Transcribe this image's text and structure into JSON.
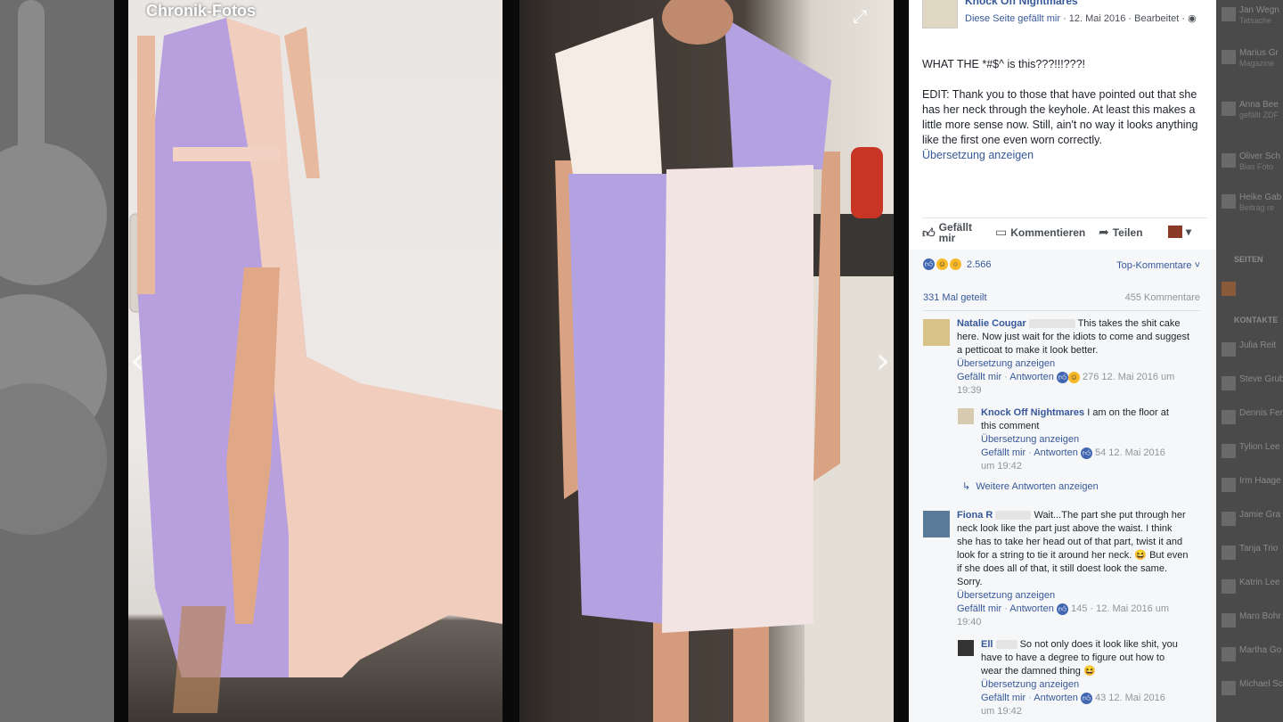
{
  "photo_viewer": {
    "label": "Chronik-Fotos",
    "prev_arrow": "‹",
    "next_arrow": "›",
    "expand_icon": "⤢"
  },
  "post": {
    "page_name": "Knock Off Nightmares",
    "meta_like": "Diese Seite gefällt mir",
    "meta_date": "· 12. Mai 2016 · Bearbeitet ·",
    "text_line1": "WHAT THE *#$^ is this???!!!???!",
    "text_edit": "EDIT: Thank you to those that have pointed out that she has her neck through the keyhole. At least this makes a little more sense now. Still, ain't no way it looks anything like the first one even worn correctly.",
    "translate": "Übersetzung anzeigen"
  },
  "actions": {
    "like": "Gefällt mir",
    "comment": "Kommentieren",
    "share": "Teilen"
  },
  "feedback": {
    "reactions_count": "2.566",
    "top_comments": "Top-Kommentare ˅",
    "shares": "331 Mal geteilt",
    "comments": "455 Kommentare"
  },
  "comments": [
    {
      "name": "Natalie Cougar",
      "text": "This takes the shit cake here. Now just wait for the idiots to come and suggest a petticoat to make it look better.",
      "translate": "Übersetzung anzeigen",
      "like": "Gefällt mir",
      "reply": "Antworten",
      "reactions": "276",
      "date": "12. Mai 2016 um 19:39"
    },
    {
      "name": "Knock Off Nightmares",
      "text": "I am on the floor at this comment",
      "translate": "Übersetzung anzeigen",
      "like": "Gefällt mir",
      "reply": "Antworten",
      "reactions": "54",
      "date": "12. Mai 2016 um 19:42"
    },
    {
      "more": "Weitere Antworten anzeigen"
    },
    {
      "name": "Fiona R",
      "text": "Wait...The part she put through her neck look like the part just above the waist. I think she has to take her head out of that part, twist it and look for a string to tie it around her neck. 😆 But even if she does all of that, it still doest look the same. Sorry.",
      "translate": "Übersetzung anzeigen",
      "like": "Gefällt mir",
      "reply": "Antworten",
      "reactions": "145",
      "date": "12. Mai 2016 um 19:40"
    },
    {
      "name": "Ell",
      "text": "So not only does it look like shit, you have to have a degree to figure out how to wear the damned thing 😆",
      "translate": "Übersetzung anzeigen",
      "like": "Gefällt mir",
      "reply": "Antworten",
      "reactions": "43",
      "date": "12. Mai 2016 um 19:42"
    }
  ],
  "right_sidebar": {
    "items": [
      {
        "name": "Jan Wegn",
        "sub": "Tatsache"
      },
      {
        "name": "Marius Gr",
        "sub": "Magazine"
      },
      {
        "name": "Anna Bee",
        "sub": "gefällt ZDF"
      },
      {
        "name": "Oliver Sch",
        "sub": "Bias Foto"
      },
      {
        "name": "Heike Gab",
        "sub": "Beitrag re"
      }
    ],
    "section1": "SEITEN",
    "section2": "KONTAKTE",
    "contacts": [
      "Julia Reit",
      "Steve Grub",
      "Dennis Fer",
      "Tylion Lee",
      "Irm Haage",
      "Jamie Gra",
      "Tanja Trio",
      "Katrin Lee",
      "Maro Bohr",
      "Martha Go",
      "Michael Sc"
    ]
  },
  "colors": {
    "link": "#365899",
    "text": "#1d2129",
    "muted": "#90949c",
    "dress_purple": "#b6a0e0",
    "dress_peach": "#f3d3c6"
  }
}
